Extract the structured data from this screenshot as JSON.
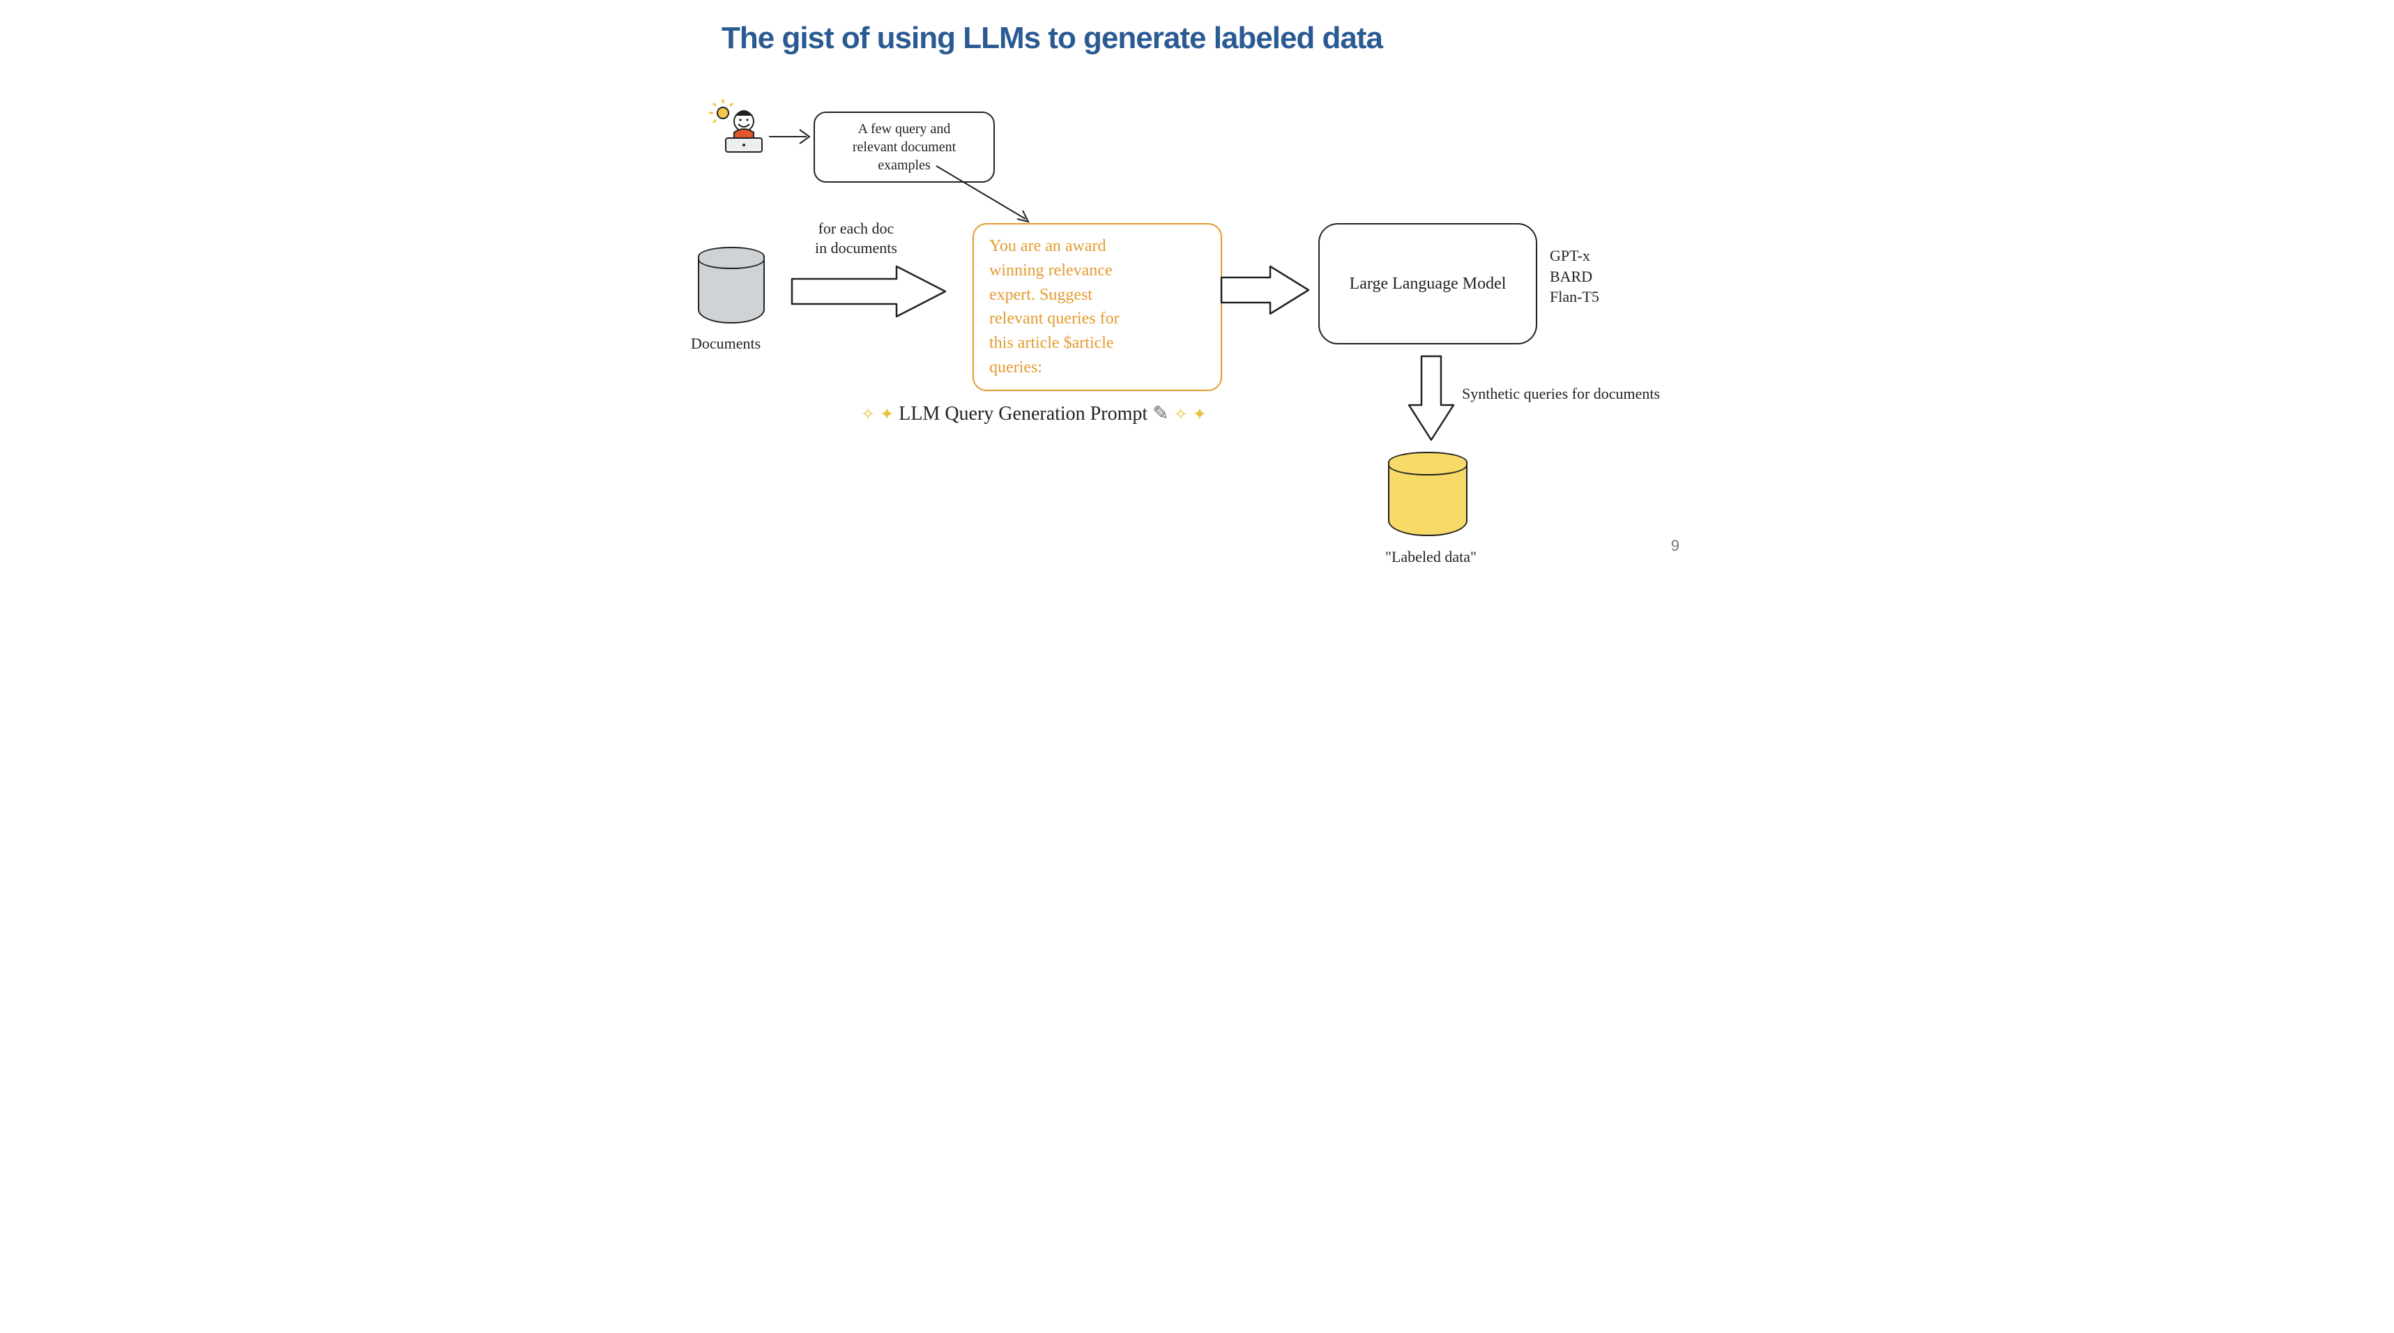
{
  "title": "The gist of using LLMs to generate labeled data",
  "pageNumber": "9",
  "examples": {
    "text": "A few query and\nrelevant document\nexamples"
  },
  "documents": {
    "label": "Documents"
  },
  "loopText": "for each doc\nin documents",
  "prompt": {
    "text": "You are an award\nwinning relevance\nexpert. Suggest\nrelevant queries for\nthis article $article\nqueries:",
    "caption": "LLM Query Generation Prompt"
  },
  "llm": {
    "box": "Large Language Model",
    "models": "GPT-x\nBARD\nFlan-T5"
  },
  "outputArrow": "Synthetic queries for documents",
  "labeled": {
    "caption": "\"Labeled data\""
  },
  "icons": {
    "sparkle": "✦",
    "sparkleSmall": "✧",
    "pencil": "✎"
  }
}
